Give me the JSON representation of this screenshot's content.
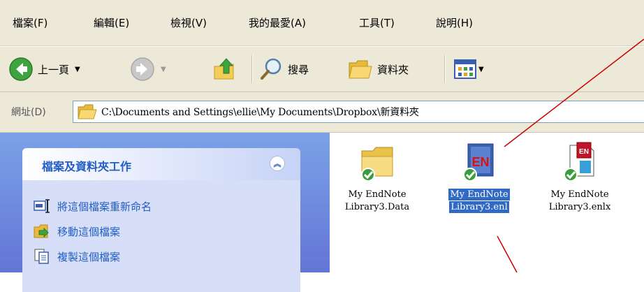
{
  "menubar": {
    "items": [
      "檔案(F)",
      "編輯(E)",
      "檢視(V)",
      "我的最愛(A)",
      "工具(T)",
      "說明(H)"
    ]
  },
  "toolbar": {
    "back_label": "上一頁",
    "search_label": "搜尋",
    "folders_label": "資料夾"
  },
  "address": {
    "label": "網址(D)",
    "path": "C:\\Documents and Settings\\ellie\\My Documents\\Dropbox\\新資料夾"
  },
  "tasks": {
    "title": "檔案及資料夾工作",
    "items": [
      {
        "label": "將這個檔案重新命名",
        "icon": "rename-icon"
      },
      {
        "label": "移動這個檔案",
        "icon": "move-icon"
      },
      {
        "label": "複製這個檔案",
        "icon": "copy-icon"
      }
    ]
  },
  "files": [
    {
      "line1": "My EndNote",
      "line2": "Library3.Data",
      "icon": "folder-icon",
      "selected": false
    },
    {
      "line1": "My EndNote",
      "line2": "Library3.enl",
      "icon": "endnote-library-icon",
      "selected": true
    },
    {
      "line1": "My EndNote",
      "line2": "Library3.enlx",
      "icon": "endnote-compressed-icon",
      "selected": false
    }
  ],
  "colors": {
    "chrome": "#ece9d8",
    "task_pane": "#6375d6",
    "task_link": "#215dc6",
    "selection": "#316ac5",
    "annotation": "#cc0000",
    "sync_check": "#3a9d3a"
  }
}
